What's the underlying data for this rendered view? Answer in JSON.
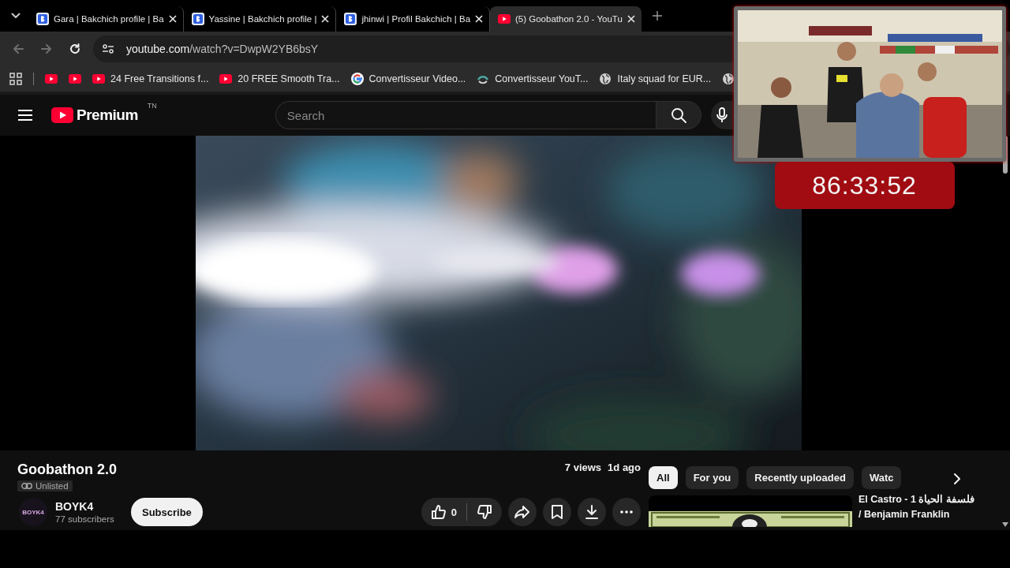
{
  "browser": {
    "tabs": [
      {
        "title": "Gara | Bakchich profile | Ba",
        "kind": "bakchich",
        "selected": false
      },
      {
        "title": "Yassine | Bakchich profile |",
        "kind": "bakchich",
        "selected": false
      },
      {
        "title": "jhinwi | Profil Bakchich | Ba",
        "kind": "bakchich",
        "selected": false
      },
      {
        "title": "(5) Goobathon 2.0 - YouTu",
        "kind": "youtube",
        "selected": true
      }
    ],
    "url": {
      "host": "youtube.com",
      "path": "/watch?v=DwpW2YB6bsY"
    },
    "bookmarks": [
      {
        "kind": "youtube"
      },
      {
        "kind": "youtube"
      },
      {
        "kind": "youtube",
        "label": "24 Free Transitions f..."
      },
      {
        "kind": "youtube",
        "label": "20 FREE Smooth Tra..."
      },
      {
        "kind": "google",
        "label": "Convertisseur Video..."
      },
      {
        "kind": "swirl",
        "label": "Convertisseur YouT..."
      },
      {
        "kind": "globe",
        "label": "Italy squad for EUR..."
      },
      {
        "kind": "globe"
      }
    ]
  },
  "youtube": {
    "logo": "Premium",
    "country": "TN",
    "search": {
      "placeholder": "Search"
    },
    "video": {
      "kind": "picture",
      "title": "Goobathon 2.0",
      "visibility": "Unlisted",
      "views": "7 views",
      "age": "1d ago",
      "channel": {
        "name": "BOYK4",
        "avatar_text": "BOYK4",
        "subscribers": "77 subscribers"
      },
      "subscribe": "Subscribe",
      "likes": "0"
    },
    "chips": [
      {
        "label": "All",
        "selected": true
      },
      {
        "label": "For you",
        "selected": false
      },
      {
        "label": "Recently uploaded",
        "selected": false
      },
      {
        "label": "Watc",
        "selected": false
      }
    ],
    "recommendations": [
      {
        "kind": "picture",
        "title": "El Castro - 1 فلسفة الحياة / Benjamin Franklin"
      }
    ]
  },
  "stream_overlay": {
    "kind": "picture",
    "timer": "86:33:52"
  }
}
